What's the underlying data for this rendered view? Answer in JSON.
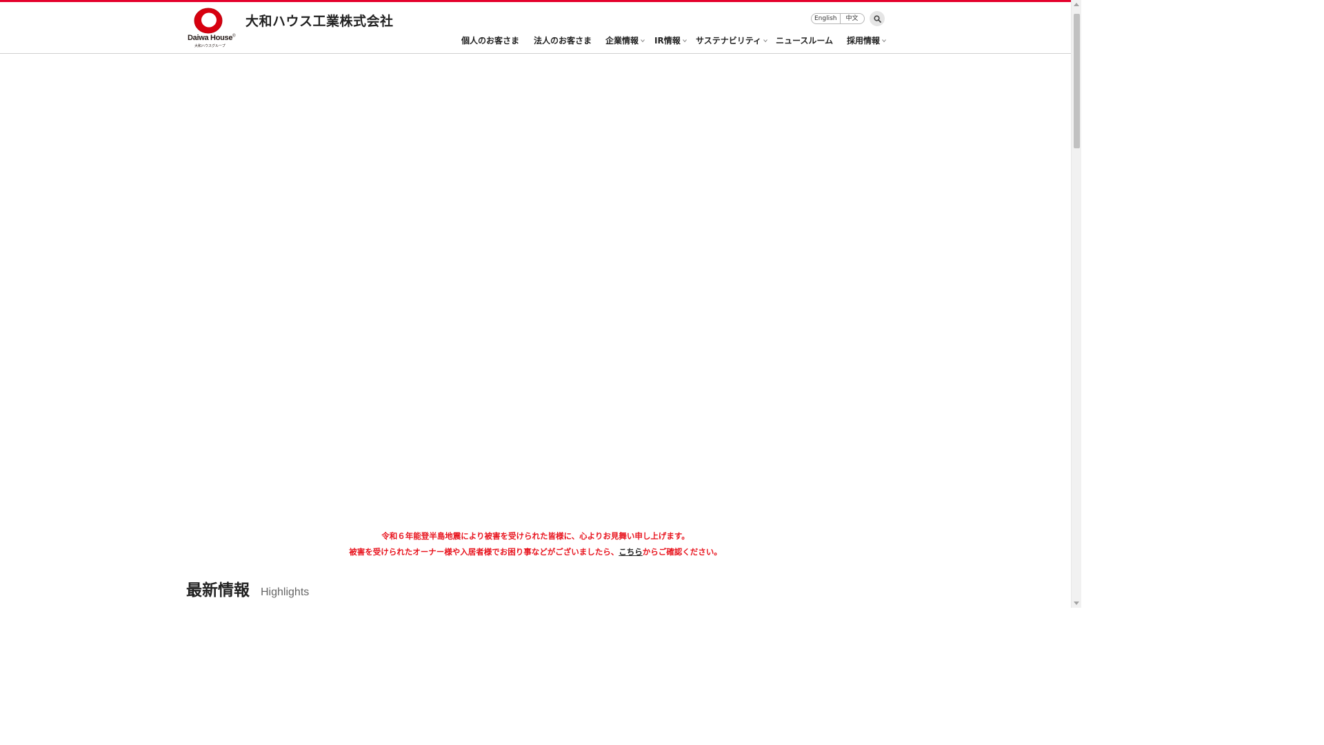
{
  "brand": {
    "logo_word": "Daiwa House",
    "logo_reg": "®",
    "logo_sub": "大和ハウスグループ",
    "company_name": "大和ハウス工業株式会社",
    "accent_color": "#e4002b"
  },
  "header": {
    "languages": [
      {
        "label": "English"
      },
      {
        "label": "中文"
      }
    ],
    "search_icon": "search-icon"
  },
  "nav": {
    "items": [
      {
        "label": "個人のお客さま",
        "has_dropdown": false
      },
      {
        "label": "法人のお客さま",
        "has_dropdown": false
      },
      {
        "label": "企業情報",
        "has_dropdown": true
      },
      {
        "label": "IR情報",
        "has_dropdown": true
      },
      {
        "label": "サステナビリティ",
        "has_dropdown": true
      },
      {
        "label": "ニュースルーム",
        "has_dropdown": false
      },
      {
        "label": "採用情報",
        "has_dropdown": true
      }
    ]
  },
  "notice": {
    "line1": "令和６年能登半島地震により被害を受けられた皆様に、心よりお見舞い申し上げます。",
    "line2_before": "被害を受けられたオーナー様や入居者様でお困り事などがございましたら、",
    "line2_link": "こちら",
    "line2_after": "からご確認ください。",
    "color": "#e8141e"
  },
  "highlights": {
    "title_ja": "最新情報",
    "title_en": "Highlights"
  }
}
